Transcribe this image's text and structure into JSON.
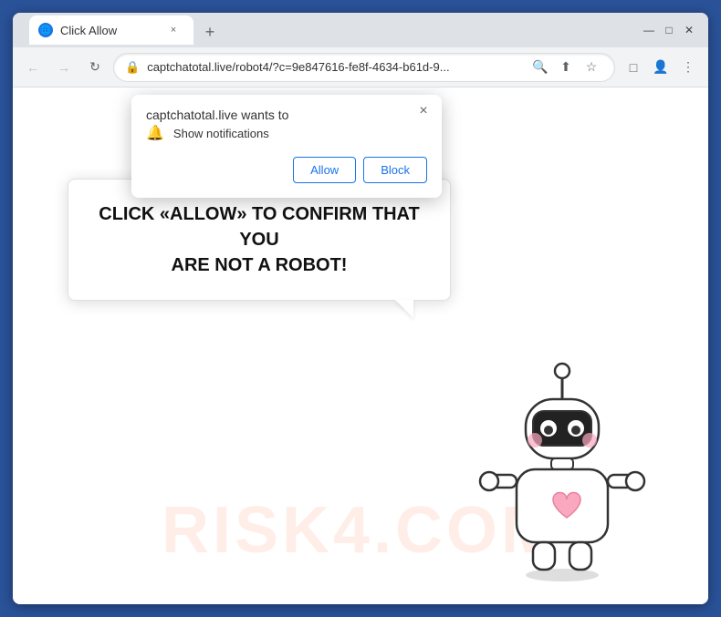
{
  "browser": {
    "title_bar": {
      "tab_favicon": "C",
      "tab_title": "Click Allow",
      "tab_close_label": "×",
      "new_tab_label": "+",
      "window_controls": {
        "minimize": "—",
        "maximize": "□",
        "close": "✕"
      }
    },
    "address_bar": {
      "back_btn": "←",
      "forward_btn": "→",
      "reload_btn": "↻",
      "url": "captchatotal.live/robot4/?c=9e847616-fe8f-4634-b61d-9...",
      "search_icon": "🔍",
      "share_icon": "⬆",
      "bookmark_icon": "☆",
      "extensions_icon": "□",
      "profile_icon": "👤",
      "menu_icon": "⋮"
    },
    "notification_popup": {
      "title": "captchatotal.live wants to",
      "close_label": "×",
      "notification_text": "Show notifications",
      "allow_label": "Allow",
      "block_label": "Block"
    },
    "page": {
      "main_message_line1": "CLICK «ALLOW» TO CONFIRM THAT YOU",
      "main_message_line2": "ARE NOT A ROBOT!",
      "watermark_text": "RISK4.COM"
    }
  }
}
